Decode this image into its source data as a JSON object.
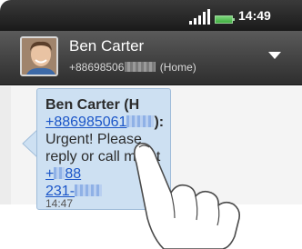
{
  "status_bar": {
    "time": "14:49",
    "icons": [
      "signal-icon",
      "battery-icon"
    ]
  },
  "contact": {
    "name": "Ben Carter",
    "number_prefix": "+88698506",
    "number_suffix": "(Home)"
  },
  "message": {
    "sender_name": "Ben Carter (H",
    "sender_number_visible": "+886985061",
    "sender_number_suffix": "):",
    "body_text": "Urgent! Please reply or call me at",
    "link_part1": "+",
    "link_part2": "88",
    "link_part3": "231-",
    "time": "14:47"
  },
  "colors": {
    "bubble": "#cde0f2",
    "link": "#1a55c8",
    "header": "#3a3a3a"
  }
}
